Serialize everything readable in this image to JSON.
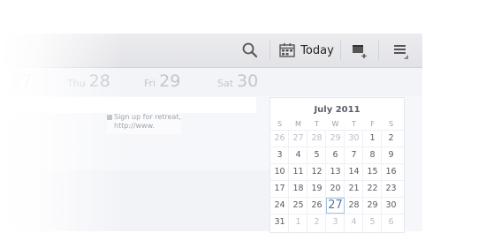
{
  "actionbar": {
    "today_label": "Today",
    "icons": [
      "search-icon",
      "calendar-grid-icon",
      "new-event-icon",
      "overflow-menu-icon"
    ]
  },
  "week": {
    "days": [
      {
        "name": "",
        "date": "27"
      },
      {
        "name": "Thu",
        "date": "28"
      },
      {
        "name": "Fri",
        "date": "29"
      },
      {
        "name": "Sat",
        "date": "30"
      }
    ]
  },
  "event": {
    "text": "Sign up for retreat,\nhttp://www."
  },
  "mini_calendar": {
    "title": "July 2011",
    "weekdays": [
      "S",
      "M",
      "T",
      "W",
      "T",
      "F",
      "S"
    ],
    "rows": [
      [
        "26",
        "27",
        "28",
        "29",
        "30",
        "1",
        "2"
      ],
      [
        "3",
        "4",
        "5",
        "6",
        "7",
        "8",
        "9"
      ],
      [
        "10",
        "11",
        "12",
        "13",
        "14",
        "15",
        "16"
      ],
      [
        "17",
        "18",
        "19",
        "20",
        "21",
        "22",
        "23"
      ],
      [
        "24",
        "25",
        "26",
        "27",
        "28",
        "29",
        "30"
      ],
      [
        "31",
        "1",
        "2",
        "3",
        "4",
        "5",
        "6"
      ]
    ],
    "today": "27"
  },
  "colors": {
    "accent": "#4f77a8",
    "actionbar": "#e4e5e9"
  }
}
